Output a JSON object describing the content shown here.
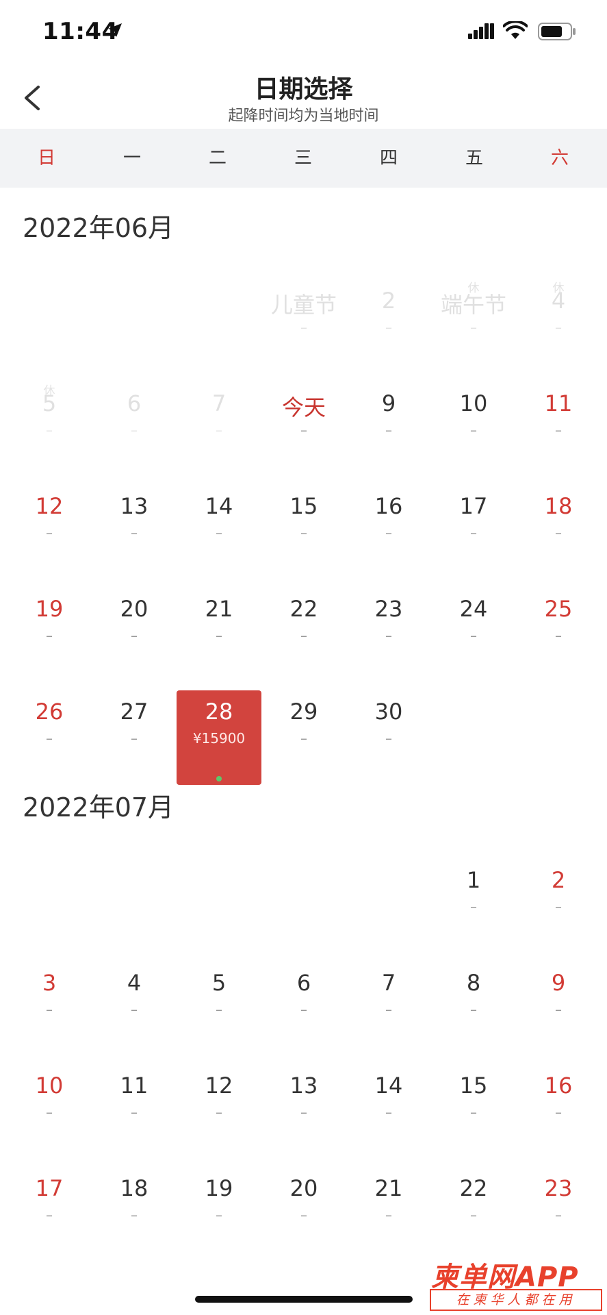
{
  "status_bar": {
    "time": "11:44"
  },
  "header": {
    "title": "日期选择",
    "subtitle": "起降时间均为当地时间"
  },
  "weekdays": [
    "日",
    "一",
    "二",
    "三",
    "四",
    "五",
    "六"
  ],
  "months": [
    {
      "title": "2022年06月",
      "days": [
        {
          "label": "儿童节",
          "price": "–",
          "state": "disabled"
        },
        {
          "label": "2",
          "price": "–",
          "state": "disabled"
        },
        {
          "label": "端午节",
          "price": "–",
          "state": "disabled",
          "holiday": "休"
        },
        {
          "label": "4",
          "price": "–",
          "state": "disabled",
          "holiday": "休"
        },
        {
          "label": "5",
          "price": "–",
          "state": "disabled",
          "holiday": "休"
        },
        {
          "label": "6",
          "price": "–",
          "state": "disabled"
        },
        {
          "label": "7",
          "price": "–",
          "state": "disabled"
        },
        {
          "label": "今天",
          "price": "–",
          "state": "today"
        },
        {
          "label": "9",
          "price": "–"
        },
        {
          "label": "10",
          "price": "–"
        },
        {
          "label": "11",
          "price": "–"
        },
        {
          "label": "12",
          "price": "–"
        },
        {
          "label": "13",
          "price": "–"
        },
        {
          "label": "14",
          "price": "–"
        },
        {
          "label": "15",
          "price": "–"
        },
        {
          "label": "16",
          "price": "–"
        },
        {
          "label": "17",
          "price": "–"
        },
        {
          "label": "18",
          "price": "–"
        },
        {
          "label": "19",
          "price": "–"
        },
        {
          "label": "20",
          "price": "–"
        },
        {
          "label": "21",
          "price": "–"
        },
        {
          "label": "22",
          "price": "–"
        },
        {
          "label": "23",
          "price": "–"
        },
        {
          "label": "24",
          "price": "–"
        },
        {
          "label": "25",
          "price": "–"
        },
        {
          "label": "26",
          "price": "–"
        },
        {
          "label": "27",
          "price": "–"
        },
        {
          "label": "28",
          "price": "¥15900",
          "state": "selected"
        },
        {
          "label": "29",
          "price": "–"
        },
        {
          "label": "30",
          "price": "–"
        }
      ]
    },
    {
      "title": "2022年07月",
      "days": [
        {
          "label": "1",
          "price": "–"
        },
        {
          "label": "2",
          "price": "–"
        },
        {
          "label": "3",
          "price": "–"
        },
        {
          "label": "4",
          "price": "–"
        },
        {
          "label": "5",
          "price": "–"
        },
        {
          "label": "6",
          "price": "–"
        },
        {
          "label": "7",
          "price": "–"
        },
        {
          "label": "8",
          "price": "–"
        },
        {
          "label": "9",
          "price": "–"
        },
        {
          "label": "10",
          "price": "–"
        },
        {
          "label": "11",
          "price": "–"
        },
        {
          "label": "12",
          "price": "–"
        },
        {
          "label": "13",
          "price": "–"
        },
        {
          "label": "14",
          "price": "–"
        },
        {
          "label": "15",
          "price": "–"
        },
        {
          "label": "16",
          "price": "–"
        },
        {
          "label": "17",
          "price": "–"
        },
        {
          "label": "18",
          "price": "–"
        },
        {
          "label": "19",
          "price": "–"
        },
        {
          "label": "20",
          "price": "–"
        },
        {
          "label": "21",
          "price": "–"
        },
        {
          "label": "22",
          "price": "–"
        },
        {
          "label": "23",
          "price": "–"
        }
      ]
    }
  ],
  "watermark": {
    "line1": "柬单网APP",
    "line2": "在柬华人都在用"
  },
  "colors": {
    "accent_red": "#d23b35",
    "selected_bg": "#d2443e",
    "header_bg": "#f2f3f5",
    "dot_green": "#5cc86a"
  }
}
